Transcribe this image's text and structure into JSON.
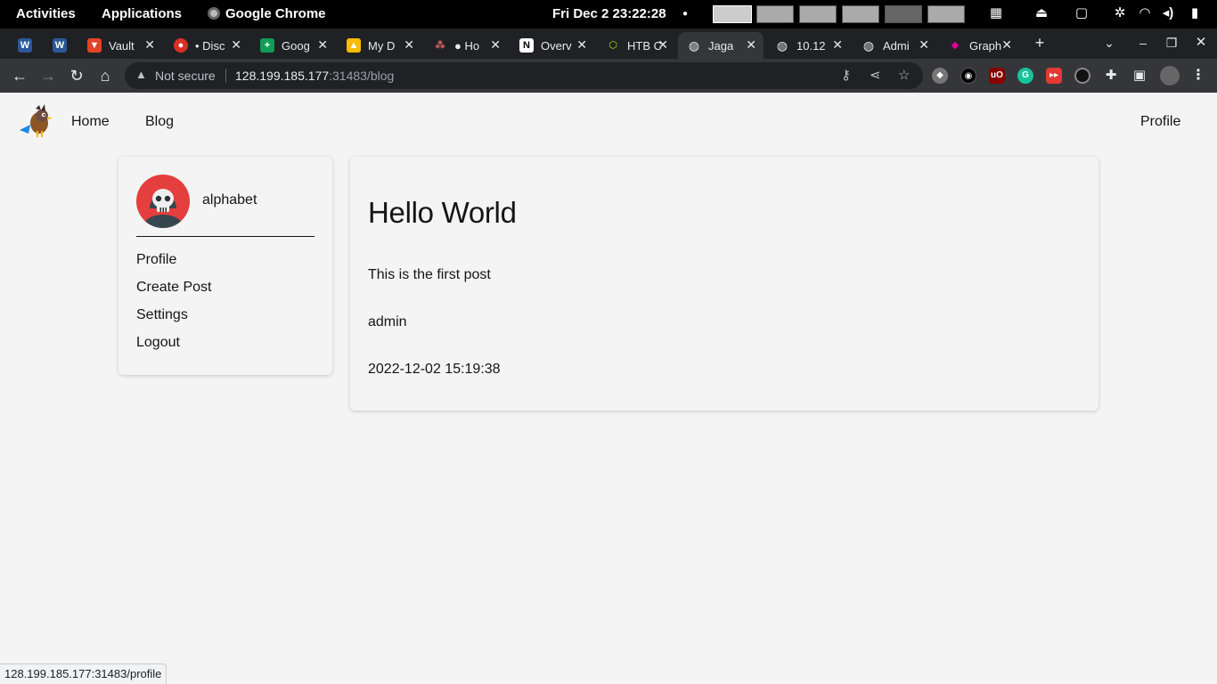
{
  "system_bar": {
    "activities": "Activities",
    "applications": "Applications",
    "app_name": "Google Chrome",
    "datetime": "Fri Dec 2  23:22:28"
  },
  "tabs": [
    {
      "title": "",
      "favicon": "word-icon",
      "color": "#2b579a"
    },
    {
      "title": "",
      "favicon": "word-icon",
      "color": "#2b579a"
    },
    {
      "title": "Vault",
      "favicon": "gitlab-icon",
      "color": "#e24329"
    },
    {
      "title": "• Disc",
      "favicon": "chrome-ext-icon",
      "color": "#d93025"
    },
    {
      "title": "Goog",
      "favicon": "sheets-icon",
      "color": "#0f9d58"
    },
    {
      "title": "My D",
      "favicon": "drive-icon",
      "color": "#4285f4"
    },
    {
      "title": "● Ho",
      "favicon": "asana-icon",
      "color": "#f06a6a"
    },
    {
      "title": "Overv",
      "favicon": "notion-icon",
      "color": "#202124"
    },
    {
      "title": "HTB C",
      "favicon": "htb-icon",
      "color": "#9fef00"
    },
    {
      "title": "Jaga",
      "favicon": "globe-icon",
      "color": "#35363a"
    },
    {
      "title": "10.12",
      "favicon": "globe-icon",
      "color": "#202124"
    },
    {
      "title": "Admi",
      "favicon": "globe-icon",
      "color": "#202124"
    },
    {
      "title": "Graph",
      "favicon": "graphql-icon",
      "color": "#e10098"
    }
  ],
  "address_bar": {
    "security_label": "Not secure",
    "url_host": "128.199.185.177",
    "url_path": ":31483/blog"
  },
  "site_nav": {
    "home": "Home",
    "blog": "Blog",
    "profile": "Profile"
  },
  "sidebar": {
    "username": "alphabet",
    "menu": [
      "Profile",
      "Create Post",
      "Settings",
      "Logout"
    ]
  },
  "post": {
    "title": "Hello World",
    "body": "This is the first post",
    "author": "admin",
    "date": "2022-12-02 15:19:38"
  },
  "status_url": "128.199.185.177:31483/profile"
}
